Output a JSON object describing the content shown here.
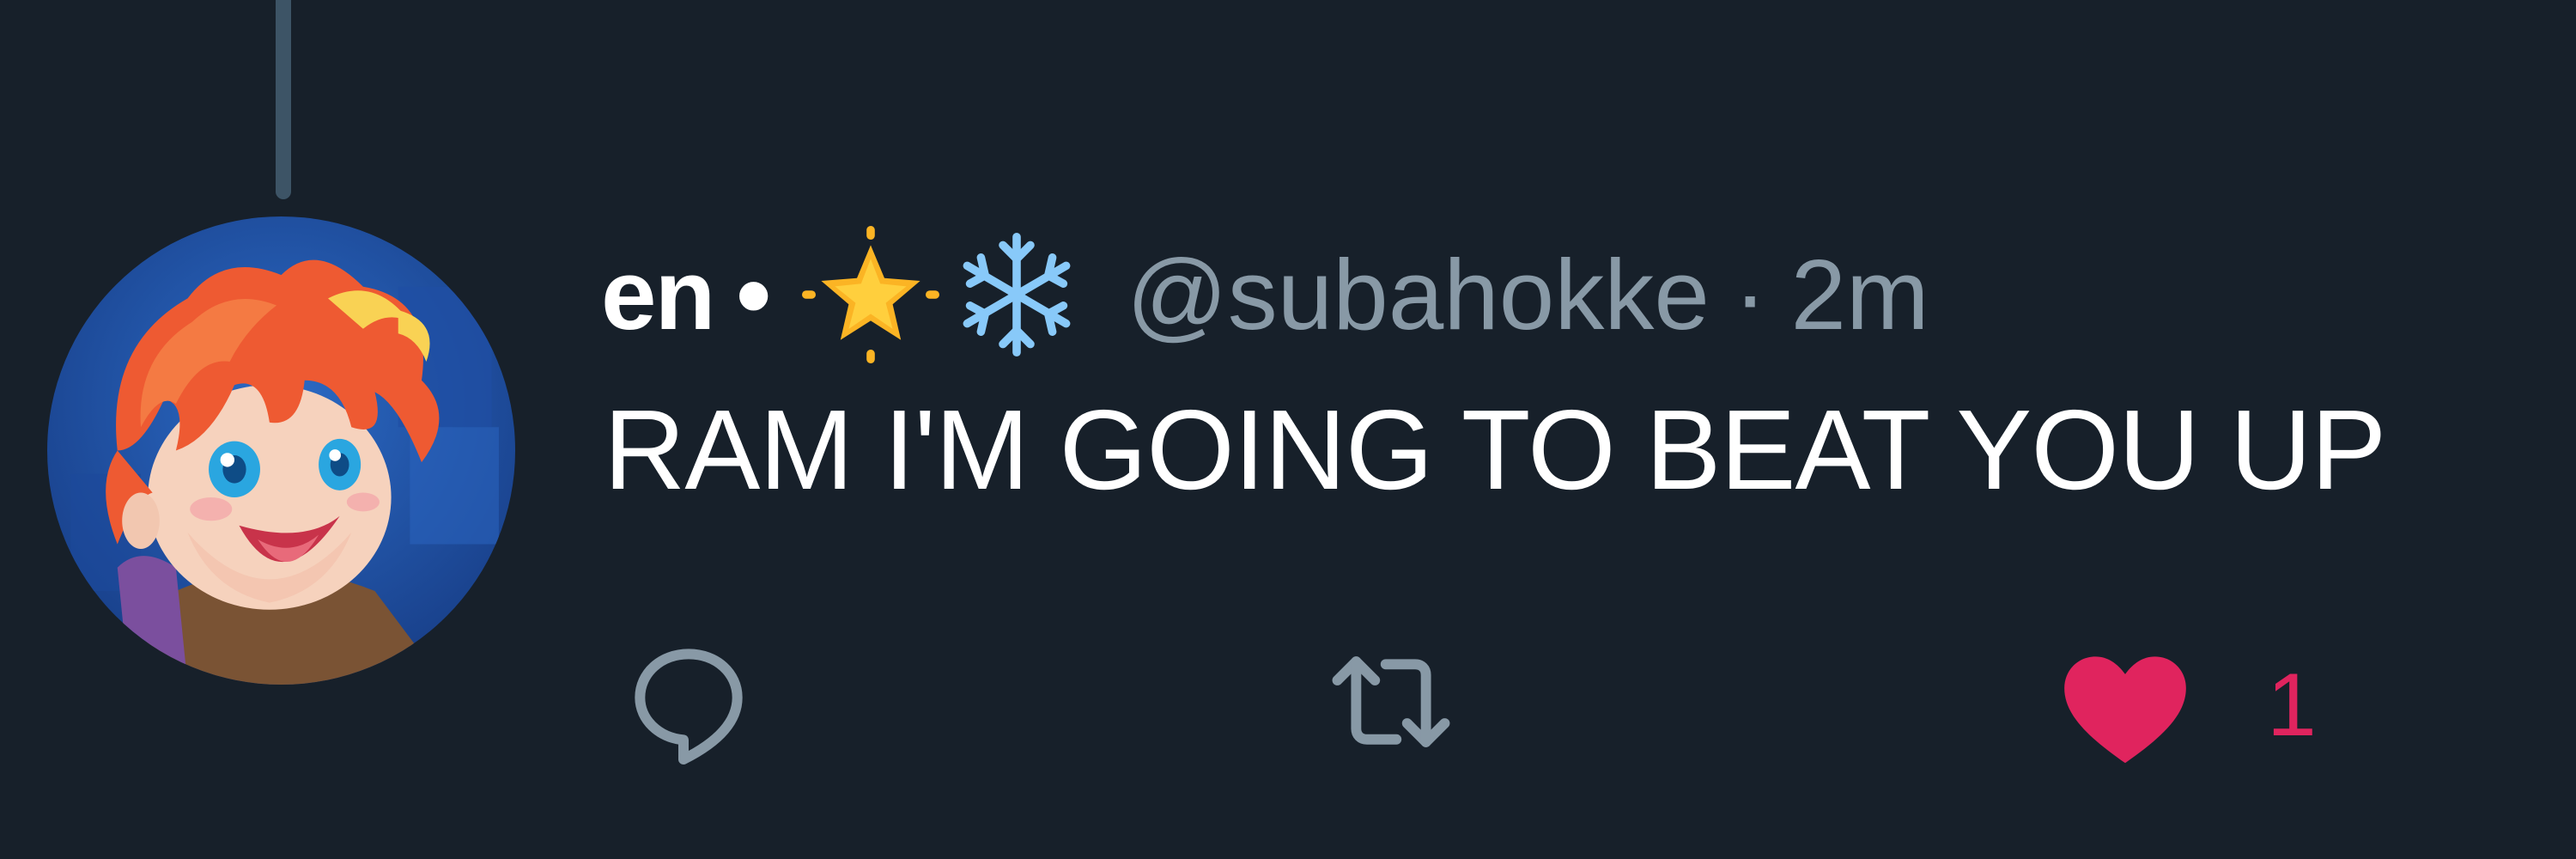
{
  "tweet": {
    "display_name": "en",
    "name_separator": "•",
    "name_emoji": [
      "star-icon",
      "snowflake-icon"
    ],
    "handle": "@subahokke",
    "time_separator": "·",
    "time": "2m",
    "text": "RAM I'M GOING TO BEAT YOU UP"
  },
  "actions": {
    "reply_icon": "reply-icon",
    "retweet_icon": "retweet-icon",
    "like_icon": "heart-icon",
    "like_count": "1"
  },
  "colors": {
    "background": "#17202a",
    "primary_text": "#ffffff",
    "secondary_text": "#8899a6",
    "like_active": "#e0245e",
    "thread_line": "#3d5466"
  }
}
